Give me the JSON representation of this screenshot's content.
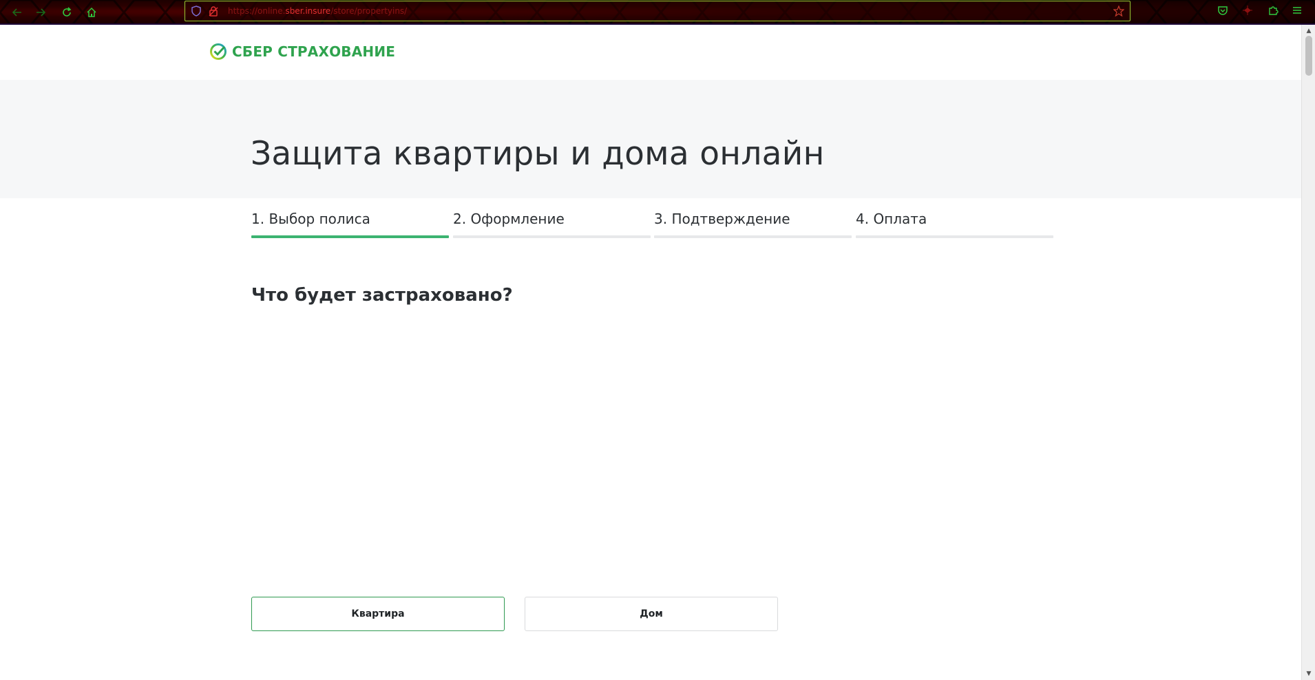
{
  "browser": {
    "url_prefix": "https://online.",
    "url_domain": "sber.insure",
    "url_suffix": "/store/propertyins/",
    "icons": {
      "back": "arrow-left-icon",
      "forward": "arrow-right-icon",
      "reload": "reload-icon",
      "home": "home-icon",
      "tracking_protection": "shield-icon",
      "security": "lock-icon",
      "bookmark": "star-icon",
      "pocket": "pocket-icon",
      "sync": "sync-icon",
      "extensions": "puzzle-icon",
      "menu": "hamburger-icon"
    },
    "colors": {
      "accent_green": "#2ecc40",
      "url_border": "#9acd32",
      "url_text": "#8a1414"
    }
  },
  "site": {
    "logo_text": "СБЕР СТРАХОВАНИЕ",
    "logo_color": "#2fa34e",
    "title": "Защита квартиры и дома онлайн",
    "steps": [
      {
        "label": "1. Выбор полиса",
        "active": true
      },
      {
        "label": "2. Оформление",
        "active": false
      },
      {
        "label": "3. Подтверждение",
        "active": false
      },
      {
        "label": "4. Оплата",
        "active": false
      }
    ],
    "question": "Что будет застраховано?",
    "options": [
      {
        "label": "Квартира",
        "selected": true
      },
      {
        "label": "Дом",
        "selected": false
      }
    ],
    "colors": {
      "active_step": "#3cb371",
      "inactive_step": "#e7e8ea",
      "selected_border": "#2e9950",
      "hero_bg": "#f6f7f8"
    }
  }
}
